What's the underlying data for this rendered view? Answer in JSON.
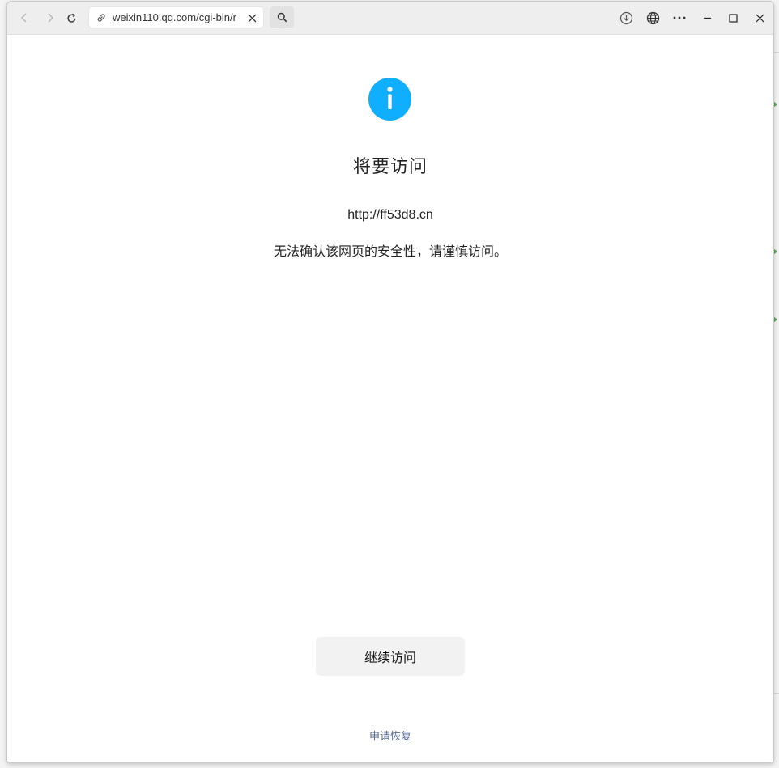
{
  "browser": {
    "address_text": "weixin110.qq.com/cgi-bin/r"
  },
  "page": {
    "title": "将要访问",
    "target_url": "http://ff53d8.cn",
    "warning": "无法确认该网页的安全性，请谨慎访问。",
    "continue_label": "继续访问",
    "restore_label": "申请恢复"
  },
  "colors": {
    "info_icon": "#10AEFF",
    "link": "#576B95",
    "button_bg": "#F2F2F2"
  },
  "icons": {
    "back": "chevron-left-icon",
    "forward": "chevron-right-icon",
    "reload": "reload-icon",
    "address_link": "link-icon",
    "address_clear": "close-icon",
    "search": "search-icon",
    "download": "download-icon",
    "translate": "globe-icon",
    "more": "more-icon",
    "minimize": "minimize-icon",
    "maximize": "maximize-icon",
    "close": "close-icon",
    "info": "info-icon"
  }
}
